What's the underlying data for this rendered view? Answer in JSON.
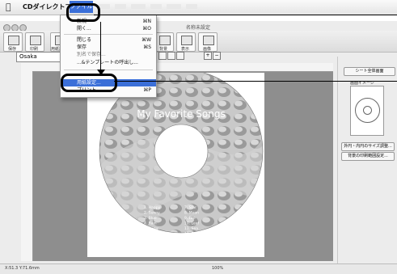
{
  "menubar": {
    "app_name": "CDダイレクトプリント",
    "file_menu": "ファイル"
  },
  "window": {
    "title": "名称未設定"
  },
  "toolbar": {
    "tools": [
      {
        "label": "保存",
        "icon": "save-icon"
      },
      {
        "label": "印刷",
        "icon": "print-icon"
      },
      {
        "label": "用紙設定",
        "icon": "page-setup-icon"
      },
      {
        "label": "円弧",
        "icon": "arc-text-icon"
      },
      {
        "label": "背景",
        "icon": "background-icon"
      },
      {
        "label": "表示",
        "icon": "display-icon"
      },
      {
        "label": "画像",
        "icon": "image-icon"
      }
    ],
    "font": "Osaka"
  },
  "file_menu": {
    "items": [
      {
        "label": "新規",
        "shortcut": "⌘N"
      },
      {
        "label": "開く...",
        "shortcut": "⌘O"
      },
      {
        "label": "閉じる",
        "shortcut": "⌘W"
      },
      {
        "label": "保存",
        "shortcut": "⌘S"
      },
      {
        "label": "別名で保存...",
        "shortcut": ""
      },
      {
        "label": "...&テンプレートの呼出し...",
        "shortcut": ""
      },
      {
        "label": "用紙設定...",
        "shortcut": ""
      },
      {
        "label": "プリント...",
        "shortcut": "⌘P"
      }
    ],
    "selected_index": 6
  },
  "document": {
    "title_text": "My Favorite Songs",
    "date_text": "4/1 2002",
    "tracks": [
      "1. Happy",
      "2. Sunny",
      "3. Blue",
      "4. Rain",
      "5. Snow",
      "6. Wind",
      "7. Star",
      "8. Moon",
      "9. Fire",
      "10. Leaf",
      "11. Sea",
      "12. Sky"
    ]
  },
  "right_panel": {
    "sheet_button": "シート全体画面",
    "preview_label": "画面イメージ",
    "size_button": "外円・内円のサイズ調整...",
    "bg_button": "背景の印刷範囲設定..."
  },
  "statusbar": {
    "coords": "X:51.3 Y:71.6mm",
    "zoom": "100%"
  },
  "colors": {
    "menu_highlight": "#3b6fd8",
    "canvas_gray": "#8e8e8e"
  }
}
